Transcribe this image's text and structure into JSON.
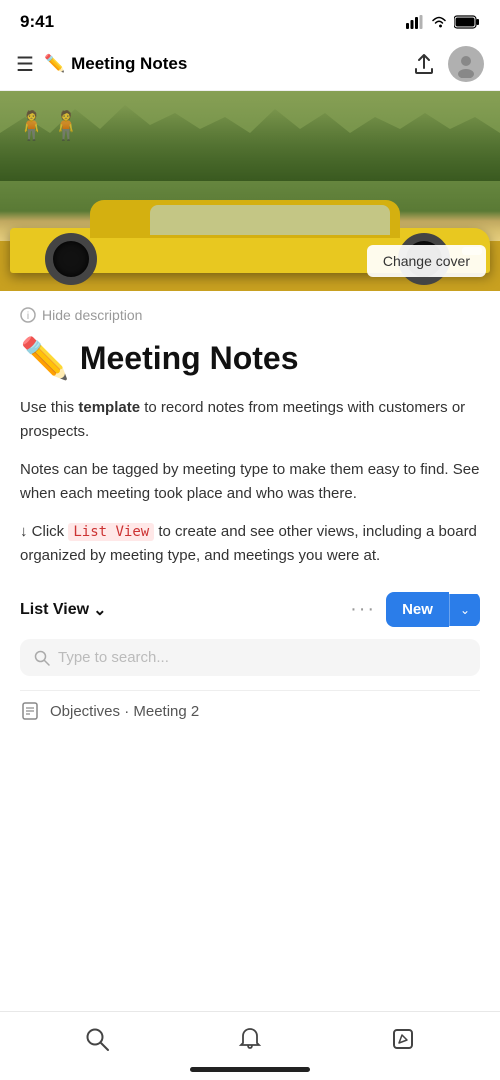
{
  "statusBar": {
    "time": "9:41",
    "signalIcon": "signal-icon",
    "wifiIcon": "wifi-icon",
    "batteryIcon": "battery-icon"
  },
  "topNav": {
    "menuIcon": "menu-icon",
    "emoji": "✏️",
    "title": "Meeting Notes",
    "shareIcon": "share-icon",
    "avatarIcon": "avatar-icon"
  },
  "hero": {
    "changeCoverLabel": "Change cover"
  },
  "content": {
    "hideDescriptionLabel": "Hide description",
    "infoIcon": "info-icon",
    "pageEmoji": "✏️",
    "pageTitle": "Meeting Notes",
    "description1Part1": "Use this ",
    "description1Bold": "template",
    "description1Part2": " to record notes from meetings with customers or prospects.",
    "description2": "Notes can be tagged by meeting type to make them easy to find. See when each meeting took place and who was there.",
    "clickInstructionPre": "↓ Click ",
    "listViewBadge": "List View",
    "clickInstructionPost": " to create and see other views, including a board organized by meeting type, and meetings you were at."
  },
  "toolbar": {
    "listViewLabel": "List View",
    "chevronIcon": "chevron-down-icon",
    "dotsIcon": "ellipsis-icon",
    "newButtonLabel": "New",
    "newChevronIcon": "chevron-down-icon"
  },
  "searchBar": {
    "placeholder": "Type to search...",
    "searchIcon": "search-icon"
  },
  "partialRow": {
    "icon": "document-icon",
    "text": "Objectives · Meeting 2"
  },
  "bottomNav": {
    "searchIcon": "search-icon",
    "bellIcon": "bell-icon",
    "editIcon": "edit-icon"
  }
}
